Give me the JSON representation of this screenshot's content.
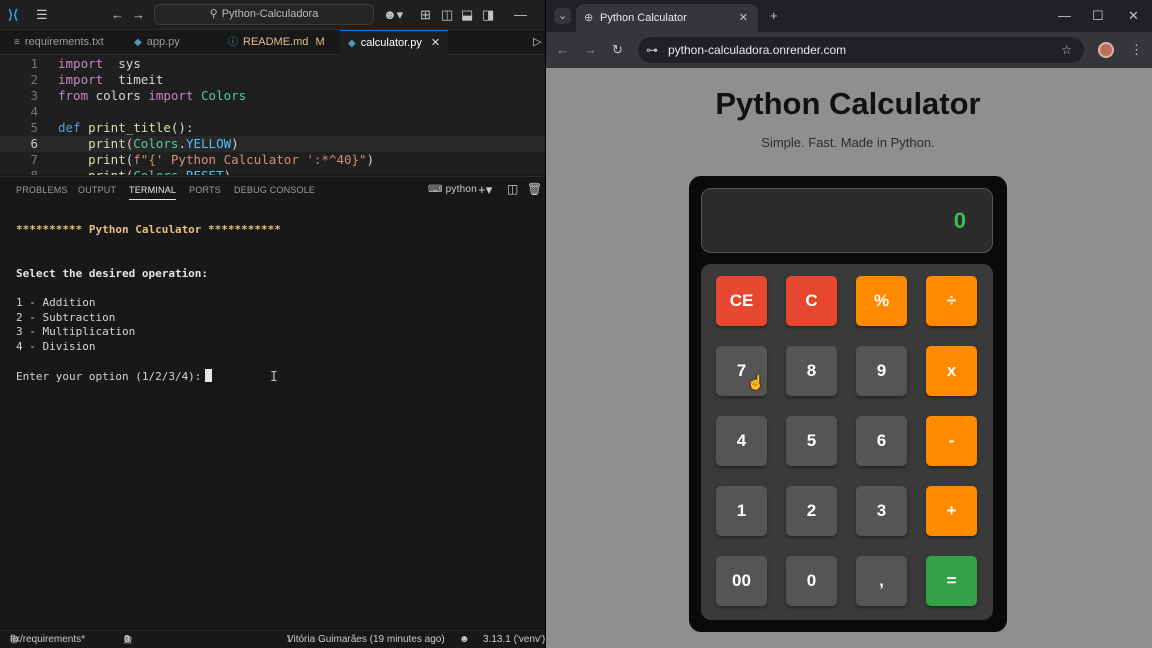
{
  "vscode": {
    "search_text": "Python-Calculadora",
    "tabs": [
      {
        "icon": "≡",
        "label": "requirements.txt"
      },
      {
        "icon": "◆",
        "label": "app.py"
      },
      {
        "icon": "ⓘ",
        "label": "README.md",
        "badge": "M"
      },
      {
        "icon": "◆",
        "label": "calculator.py",
        "close": "✕"
      }
    ],
    "code": [
      {
        "n": "1",
        "t": [
          [
            "kw",
            "import"
          ],
          [
            "",
            "  sys"
          ]
        ]
      },
      {
        "n": "2",
        "t": [
          [
            "kw",
            "import"
          ],
          [
            "",
            "  timeit"
          ]
        ]
      },
      {
        "n": "3",
        "t": [
          [
            "kw",
            "from"
          ],
          [
            "",
            " colors "
          ],
          [
            "kw",
            "import"
          ],
          [
            "",
            " "
          ],
          [
            "cl",
            "Colors"
          ]
        ]
      },
      {
        "n": "4",
        "t": []
      },
      {
        "n": "5",
        "t": [
          [
            "df",
            "def"
          ],
          [
            "",
            " "
          ],
          [
            "fn",
            "print_title"
          ],
          [
            "",
            "():"
          ]
        ]
      },
      {
        "n": "6",
        "t": [
          [
            "",
            "    "
          ],
          [
            "fn",
            "print"
          ],
          [
            "",
            "("
          ],
          [
            "cl",
            "Colors"
          ],
          [
            "",
            "."
          ],
          [
            "pr",
            "YELLOW"
          ],
          [
            "",
            ")"
          ]
        ]
      },
      {
        "n": "7",
        "t": [
          [
            "",
            "    "
          ],
          [
            "fn",
            "print"
          ],
          [
            "",
            "("
          ],
          [
            "st",
            "f\"{' Python Calculator ':*^40}\""
          ],
          [
            "",
            ")"
          ]
        ]
      },
      {
        "n": "8",
        "t": [
          [
            "",
            "    "
          ],
          [
            "fn",
            "print"
          ],
          [
            "",
            "("
          ],
          [
            "cl",
            "Colors"
          ],
          [
            "",
            "."
          ],
          [
            "pr",
            "RESET"
          ],
          [
            "",
            ")"
          ]
        ]
      }
    ],
    "panel_tabs": [
      "PROBLEMS",
      "OUTPUT",
      "TERMINAL",
      "PORTS",
      "DEBUG CONSOLE"
    ],
    "terminal_profile": "python",
    "terminal": {
      "banner": "********** Python Calculator ***********",
      "prompt_heading": "Select the desired operation:",
      "options": [
        "1 - Addition",
        "2 - Subtraction",
        "3 - Multiplication",
        "4 - Division"
      ],
      "input_prompt": "Enter your option (1/2/3/4):"
    },
    "status": {
      "branch": "fix/requirements*",
      "errors": "0",
      "warnings": "0",
      "blame": "Vitória Guimarães (19 minutes ago)",
      "python_version": "3.13.1 ('venv')"
    }
  },
  "chrome": {
    "tab_title": "Python Calculator",
    "url": "python-calculadora.onrender.com",
    "page": {
      "title": "Python Calculator",
      "subtitle": "Simple. Fast. Made in Python.",
      "display": "0",
      "keys": [
        [
          "CE",
          "C",
          "%",
          "÷"
        ],
        [
          "7",
          "8",
          "9",
          "x"
        ],
        [
          "4",
          "5",
          "6",
          "-"
        ],
        [
          "1",
          "2",
          "3",
          "+"
        ],
        [
          "00",
          "0",
          ",",
          "="
        ]
      ]
    }
  },
  "colors": {
    "vscode_bg": "#181818",
    "key_red": "#e8472f",
    "key_orange": "#ff8a00",
    "key_green": "#34a348",
    "key_gray": "#555555",
    "display_text": "#3dbf57"
  }
}
